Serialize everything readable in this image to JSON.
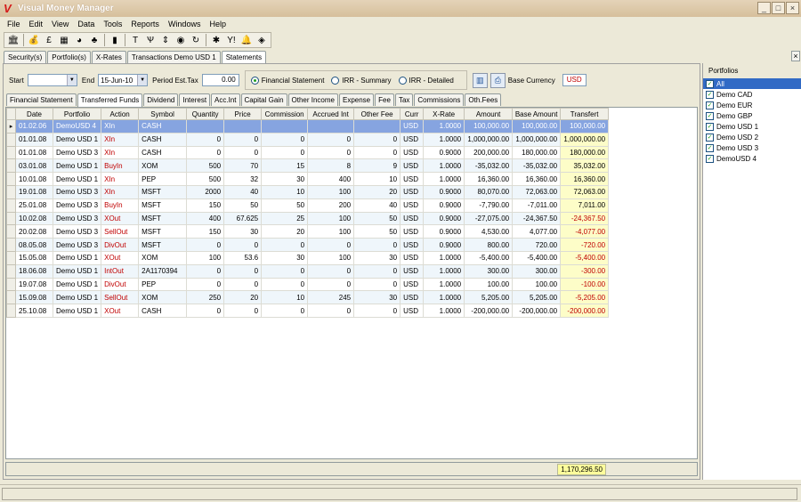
{
  "window": {
    "title": "Visual Money Manager",
    "logo": "V",
    "buttons": [
      "_",
      "□",
      "×"
    ]
  },
  "menu": [
    "File",
    "Edit",
    "View",
    "Data",
    "Tools",
    "Reports",
    "Windows",
    "Help"
  ],
  "toolbar": [
    {
      "icon": "bank-icon",
      "glyph": "🏛"
    },
    {
      "icon": "money-bag-icon",
      "glyph": "💰"
    },
    {
      "icon": "currency-exchange-icon",
      "glyph": "£"
    },
    {
      "icon": "calculator-icon",
      "glyph": "▦"
    },
    {
      "icon": "pie-chart-icon",
      "glyph": "◕"
    },
    {
      "icon": "shapes-icon",
      "glyph": "♣"
    },
    {
      "icon": "bar-chart-icon",
      "glyph": "▮"
    },
    {
      "icon": "text-icon",
      "glyph": "T"
    },
    {
      "icon": "split-icon",
      "glyph": "Ѱ"
    },
    {
      "icon": "sort-icon",
      "glyph": "⇕"
    },
    {
      "icon": "globe-icon",
      "glyph": "◉"
    },
    {
      "icon": "refresh-icon",
      "glyph": "↻"
    },
    {
      "icon": "bug-icon",
      "glyph": "✱"
    },
    {
      "icon": "yahoo-icon",
      "glyph": "Y!"
    },
    {
      "icon": "bell-icon",
      "glyph": "🔔"
    },
    {
      "icon": "tag-icon",
      "glyph": "◈"
    }
  ],
  "doc_tabs": [
    "Security(s)",
    "Portfolio(s)",
    "X-Rates",
    "Transactions Demo USD 1",
    "Statements"
  ],
  "doc_active": 4,
  "filters": {
    "start_label": "Start",
    "start_value": "",
    "end_label": "End",
    "end_value": "15-Jun-10",
    "tax_label": "Period Est.Tax",
    "tax_value": "0.00",
    "radios": [
      "Financial Statement",
      "IRR - Summary",
      "IRR - Detailed"
    ],
    "radio_selected": 0,
    "base_currency_label": "Base Currency",
    "base_currency": "USD"
  },
  "sub_tabs": [
    "Financial Statement",
    "Transferred Funds",
    "Dividend",
    "Interest",
    "Acc.Int",
    "Capital Gain",
    "Other Income",
    "Expense",
    "Fee",
    "Tax",
    "Commissions",
    "Oth.Fees"
  ],
  "sub_active": 1,
  "columns": [
    "Date",
    "Portfolio",
    "Action",
    "Symbol",
    "Quantity",
    "Price",
    "Commission",
    "Accrued Int",
    "Other Fee",
    "Curr",
    "X-Rate",
    "Amount",
    "Base Amount",
    "Transfert"
  ],
  "rows": [
    [
      "01.02.06",
      "DemoUSD 4",
      "XIn",
      "CASH",
      "",
      "",
      "",
      "",
      "",
      "USD",
      "1.0000",
      "100,000.00",
      "100,000.00",
      "100,000.00"
    ],
    [
      "01.01.08",
      "Demo USD 1",
      "XIn",
      "CASH",
      "0",
      "0",
      "0",
      "0",
      "0",
      "USD",
      "1.0000",
      "1,000,000.00",
      "1,000,000.00",
      "1,000,000.00"
    ],
    [
      "01.01.08",
      "Demo USD 3",
      "XIn",
      "CASH",
      "0",
      "0",
      "0",
      "0",
      "0",
      "USD",
      "0.9000",
      "200,000.00",
      "180,000.00",
      "180,000.00"
    ],
    [
      "03.01.08",
      "Demo USD 1",
      "BuyIn",
      "XOM",
      "500",
      "70",
      "15",
      "8",
      "9",
      "USD",
      "1.0000",
      "-35,032.00",
      "-35,032.00",
      "35,032.00"
    ],
    [
      "10.01.08",
      "Demo USD 1",
      "XIn",
      "PEP",
      "500",
      "32",
      "30",
      "400",
      "10",
      "USD",
      "1.0000",
      "16,360.00",
      "16,360.00",
      "16,360.00"
    ],
    [
      "19.01.08",
      "Demo USD 3",
      "XIn",
      "MSFT",
      "2000",
      "40",
      "10",
      "100",
      "20",
      "USD",
      "0.9000",
      "80,070.00",
      "72,063.00",
      "72,063.00"
    ],
    [
      "25.01.08",
      "Demo USD 3",
      "BuyIn",
      "MSFT",
      "150",
      "50",
      "50",
      "200",
      "40",
      "USD",
      "0.9000",
      "-7,790.00",
      "-7,011.00",
      "7,011.00"
    ],
    [
      "10.02.08",
      "Demo USD 3",
      "XOut",
      "MSFT",
      "400",
      "67.625",
      "25",
      "100",
      "50",
      "USD",
      "0.9000",
      "-27,075.00",
      "-24,367.50",
      "-24,367.50"
    ],
    [
      "20.02.08",
      "Demo USD 3",
      "SellOut",
      "MSFT",
      "150",
      "30",
      "20",
      "100",
      "50",
      "USD",
      "0.9000",
      "4,530.00",
      "4,077.00",
      "-4,077.00"
    ],
    [
      "08.05.08",
      "Demo USD 3",
      "DivOut",
      "MSFT",
      "0",
      "0",
      "0",
      "0",
      "0",
      "USD",
      "0.9000",
      "800.00",
      "720.00",
      "-720.00"
    ],
    [
      "15.05.08",
      "Demo USD 1",
      "XOut",
      "XOM",
      "100",
      "53.6",
      "30",
      "100",
      "30",
      "USD",
      "1.0000",
      "-5,400.00",
      "-5,400.00",
      "-5,400.00"
    ],
    [
      "18.06.08",
      "Demo USD 1",
      "IntOut",
      "2A1170394",
      "0",
      "0",
      "0",
      "0",
      "0",
      "USD",
      "1.0000",
      "300.00",
      "300.00",
      "-300.00"
    ],
    [
      "19.07.08",
      "Demo USD 1",
      "DivOut",
      "PEP",
      "0",
      "0",
      "0",
      "0",
      "0",
      "USD",
      "1.0000",
      "100.00",
      "100.00",
      "-100.00"
    ],
    [
      "15.09.08",
      "Demo USD 1",
      "SellOut",
      "XOM",
      "250",
      "20",
      "10",
      "245",
      "30",
      "USD",
      "1.0000",
      "5,205.00",
      "5,205.00",
      "-5,205.00"
    ],
    [
      "25.10.08",
      "Demo USD 1",
      "XOut",
      "CASH",
      "0",
      "0",
      "0",
      "0",
      "0",
      "USD",
      "1.0000",
      "-200,000.00",
      "-200,000.00",
      "-200,000.00"
    ]
  ],
  "total": "1,170,296.50",
  "portfolios_title": "Portfolios",
  "portfolios": [
    "All",
    "Demo CAD",
    "Demo EUR",
    "Demo GBP",
    "Demo USD 1",
    "Demo USD 2",
    "Demo USD 3",
    "DemoUSD 4"
  ],
  "colors": {
    "accent": "#316ac5",
    "negative": "#c00000",
    "highlight": "#fdfdc8",
    "selected_row": "#86a4e0"
  }
}
